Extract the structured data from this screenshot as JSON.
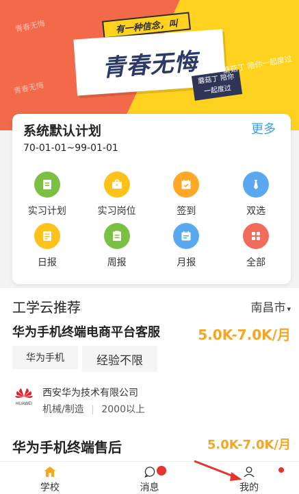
{
  "banner": {
    "bubble_text": "有一种信念，叫",
    "main_text": "青春无悔",
    "tag_text": "蘑菇丁 陪你一起度过",
    "right_text": "蘑菇丁 陪你一起度过",
    "deco1": "青春无悔",
    "deco2": "青春无悔"
  },
  "plan": {
    "title": "系统默认计划",
    "more": "更多",
    "range": "70-01-01~99-01-01",
    "items": [
      {
        "label": "实习计划",
        "icon": "plan-icon",
        "color": "#7bc043"
      },
      {
        "label": "实习岗位",
        "icon": "briefcase-icon",
        "color": "#ffc21a"
      },
      {
        "label": "签到",
        "icon": "checkin-icon",
        "color": "#ffa726"
      },
      {
        "label": "双选",
        "icon": "tie-icon",
        "color": "#5aa9f0"
      },
      {
        "label": "日报",
        "icon": "daily-report-icon",
        "color": "#ffc21a"
      },
      {
        "label": "周报",
        "icon": "weekly-report-icon",
        "color": "#7bc043"
      },
      {
        "label": "月报",
        "icon": "monthly-report-icon",
        "color": "#5aa9f0"
      },
      {
        "label": "全部",
        "icon": "grid-icon",
        "color": "#f26b5b"
      }
    ]
  },
  "recommend": {
    "title": "工学云推荐",
    "city": "南昌市",
    "job1": {
      "title": "华为手机终端电商平台客服",
      "salary": "5.0K-7.0K/月",
      "tags": [
        "华为手机",
        "经验不限"
      ],
      "company": "西安华为技术有限公司",
      "industry": "机械/制造",
      "size": "2000以上",
      "logo_text": "HUAWEI"
    },
    "job2": {
      "title": "华为手机终端售后",
      "salary": "5.0K-7.0K/月"
    }
  },
  "nav": {
    "items": [
      {
        "label": "学校",
        "icon": "home-icon"
      },
      {
        "label": "消息",
        "icon": "message-icon"
      },
      {
        "label": "我的",
        "icon": "profile-icon"
      }
    ]
  },
  "colors": {
    "accent_orange": "#f5a623",
    "link_blue": "#3aa0e8",
    "badge_red": "#e8332d"
  }
}
